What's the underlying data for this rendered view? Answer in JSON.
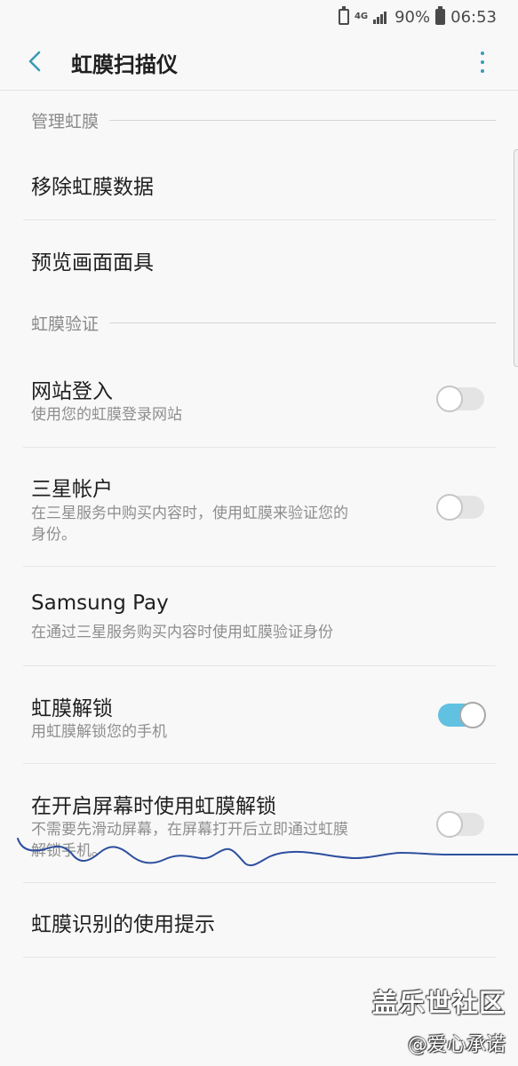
{
  "status_bar": {
    "network": "4G",
    "battery": "90%",
    "time": "06:53"
  },
  "app_bar": {
    "title": "虹膜扫描仪"
  },
  "sections": {
    "manage": {
      "header": "管理虹膜"
    },
    "verify": {
      "header": "虹膜验证"
    }
  },
  "items": {
    "remove_data": {
      "title": "移除虹膜数据"
    },
    "preview_mask": {
      "title": "预览画面面具"
    },
    "web_login": {
      "title": "网站登入",
      "subtitle": "使用您的虹膜登录网站",
      "enabled": false
    },
    "samsung_account": {
      "title": "三星帐户",
      "subtitle": "在三星服务中购买内容时，使用虹膜来验证您的身份。",
      "enabled": false
    },
    "samsung_pay": {
      "title": "Samsung Pay",
      "subtitle": "在通过三星服务购买内容时使用虹膜验证身份"
    },
    "iris_unlock": {
      "title": "虹膜解锁",
      "subtitle": "用虹膜解锁您的手机",
      "enabled": true
    },
    "screen_on_unlock": {
      "title": "在开启屏幕时使用虹膜解锁",
      "subtitle": "不需要先滑动屏幕，在屏幕打开后立即通过虹膜解锁手机。",
      "enabled": false
    },
    "usage_tips": {
      "title": "虹膜识别的使用提示"
    }
  },
  "watermark": {
    "title": "盖乐世社区",
    "sub": "@爱心承诺"
  },
  "colors": {
    "accent": "#3a9bb5",
    "toggle_on": "#61c1e0",
    "toggle_off": "#e4e4e4"
  }
}
